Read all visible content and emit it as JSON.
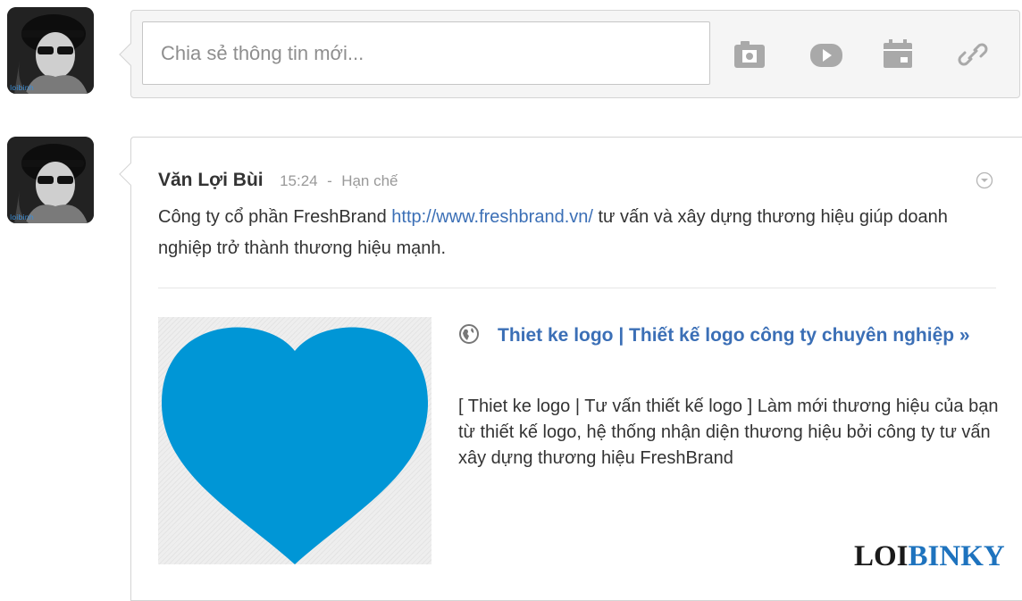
{
  "composer": {
    "placeholder": "Chia sẻ thông tin mới...",
    "tools": [
      "camera-icon",
      "video-icon",
      "calendar-icon",
      "link-icon"
    ],
    "avatar_caption": "loibinh"
  },
  "post": {
    "author": "Văn Lợi Bùi",
    "time": "15:24",
    "separator": "-",
    "visibility": "Hạn chế",
    "text_before": "Công ty cổ phần FreshBrand ",
    "link": "http://www.freshbrand.vn/",
    "text_after": " tư vấn và xây dựng thương hiệu giúp doanh nghiệp trở thành thương hiệu mạnh.",
    "avatar_caption": "loibinh",
    "preview": {
      "title": "Thiet ke logo | Thiết kế logo công ty chuyên nghiệp »",
      "description": "[ Thiet ke logo | Tư vấn thiết kế logo ] Làm mới thương hiệu của bạn từ thiết kế logo, hệ thống nhận diện thương hiệu bởi công ty tư vấn xây dựng thương hiệu FreshBrand",
      "thumbnail_icon": "heart-icon",
      "heart_color": "#0096d6"
    }
  },
  "watermark": {
    "part1": "LOI",
    "part2": "BINKY"
  },
  "colors": {
    "link": "#3b6fb6",
    "meta": "#999999",
    "watermark_blue": "#1e73be"
  }
}
